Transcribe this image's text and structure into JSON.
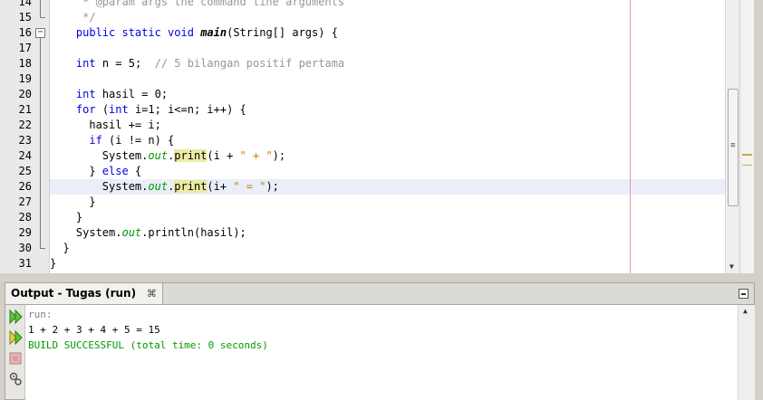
{
  "editor": {
    "lines": [
      {
        "num": "14",
        "segments": [
          {
            "t": "     ",
            "c": ""
          },
          {
            "t": "* @param args the command line arguments",
            "c": "cm"
          }
        ]
      },
      {
        "num": "15",
        "segments": [
          {
            "t": "     ",
            "c": ""
          },
          {
            "t": "*/",
            "c": "cm"
          }
        ]
      },
      {
        "num": "16",
        "segments": [
          {
            "t": "    ",
            "c": ""
          },
          {
            "t": "public static void ",
            "c": "kw"
          },
          {
            "t": "main",
            "c": "mth"
          },
          {
            "t": "(String[] args) {",
            "c": ""
          }
        ]
      },
      {
        "num": "17",
        "segments": []
      },
      {
        "num": "18",
        "segments": [
          {
            "t": "    ",
            "c": ""
          },
          {
            "t": "int",
            "c": "kw"
          },
          {
            "t": " n = 5;  ",
            "c": ""
          },
          {
            "t": "// 5 bilangan positif pertama",
            "c": "cm"
          }
        ]
      },
      {
        "num": "19",
        "segments": []
      },
      {
        "num": "20",
        "segments": [
          {
            "t": "    ",
            "c": ""
          },
          {
            "t": "int",
            "c": "kw"
          },
          {
            "t": " hasil = 0;",
            "c": ""
          }
        ]
      },
      {
        "num": "21",
        "segments": [
          {
            "t": "    ",
            "c": ""
          },
          {
            "t": "for",
            "c": "kw"
          },
          {
            "t": " (",
            "c": ""
          },
          {
            "t": "int",
            "c": "kw"
          },
          {
            "t": " i=1; i<=n; i++) {",
            "c": ""
          }
        ]
      },
      {
        "num": "22",
        "segments": [
          {
            "t": "      hasil += i;",
            "c": ""
          }
        ]
      },
      {
        "num": "23",
        "segments": [
          {
            "t": "      ",
            "c": ""
          },
          {
            "t": "if",
            "c": "kw"
          },
          {
            "t": " (i != n) {",
            "c": ""
          }
        ]
      },
      {
        "num": "24",
        "segments": [
          {
            "t": "        System.",
            "c": ""
          },
          {
            "t": "out",
            "c": "fld"
          },
          {
            "t": ".",
            "c": ""
          },
          {
            "t": "print",
            "c": "occ"
          },
          {
            "t": "(i + ",
            "c": ""
          },
          {
            "t": "\" + \"",
            "c": "str"
          },
          {
            "t": ");",
            "c": ""
          }
        ]
      },
      {
        "num": "25",
        "segments": [
          {
            "t": "      } ",
            "c": ""
          },
          {
            "t": "else",
            "c": "kw"
          },
          {
            "t": " {",
            "c": ""
          }
        ]
      },
      {
        "num": "26",
        "current": true,
        "segments": [
          {
            "t": "        System.",
            "c": ""
          },
          {
            "t": "out",
            "c": "fld"
          },
          {
            "t": ".",
            "c": ""
          },
          {
            "t": "print",
            "c": "occ"
          },
          {
            "t": "(i+ ",
            "c": ""
          },
          {
            "t": "\" = \"",
            "c": "str"
          },
          {
            "t": ");",
            "c": ""
          }
        ]
      },
      {
        "num": "27",
        "segments": [
          {
            "t": "      }",
            "c": ""
          }
        ]
      },
      {
        "num": "28",
        "segments": [
          {
            "t": "    }",
            "c": ""
          }
        ]
      },
      {
        "num": "29",
        "segments": [
          {
            "t": "    System.",
            "c": ""
          },
          {
            "t": "out",
            "c": "fld"
          },
          {
            "t": ".println(hasil);",
            "c": ""
          }
        ]
      },
      {
        "num": "30",
        "segments": [
          {
            "t": "  }",
            "c": ""
          }
        ]
      },
      {
        "num": "31",
        "segments": [
          {
            "t": "}",
            "c": ""
          }
        ]
      }
    ]
  },
  "output": {
    "title": "Output - Tugas (run)",
    "close_glyph": "⌘",
    "lines": [
      {
        "text": "run:",
        "color": "#808080"
      },
      {
        "text": "1 + 2 + 3 + 4 + 5 = 15",
        "color": "#000000"
      },
      {
        "text": "BUILD SUCCESSFUL (total time: 0 seconds)",
        "color": "#009900"
      }
    ],
    "toolbar": [
      "rerun-icon",
      "rerun-with-params-icon",
      "stop-icon",
      "settings-icon"
    ]
  },
  "colors": {
    "keyword": "#0000e6",
    "comment": "#969696",
    "string": "#ce7b00",
    "field": "#009900",
    "occurrence_highlight": "#eceba3",
    "current_line": "#e9eff8",
    "success": "#009900"
  }
}
